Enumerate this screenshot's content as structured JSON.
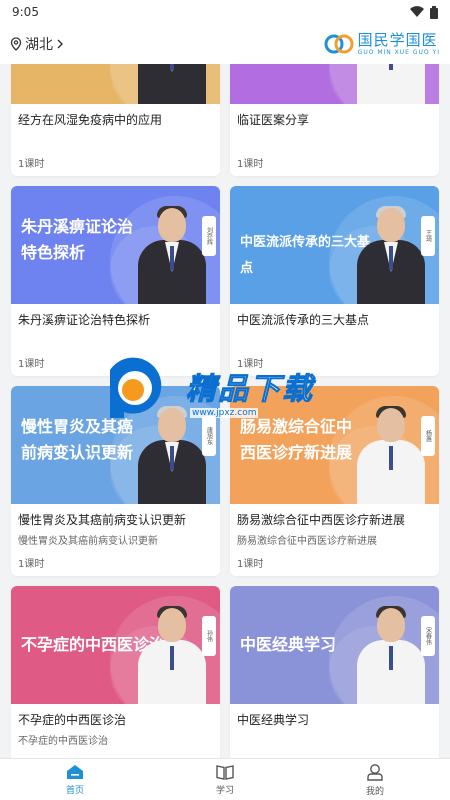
{
  "status": {
    "time": "9:05"
  },
  "header": {
    "location": "湖北",
    "brand_cn": "国民学国医",
    "brand_en": "GUO MIN XUE GUO YI"
  },
  "courses": [
    {
      "title": "经方在风湿免疫病中的应用",
      "subtitle": "",
      "lessons": "1课时",
      "thumb_title": "",
      "color": "#e6b566"
    },
    {
      "title": "临证医案分享",
      "subtitle": "",
      "lessons": "1课时",
      "thumb_title": "",
      "color": "#b26ee0"
    },
    {
      "title": "朱丹溪痹证论治特色探析",
      "subtitle": "",
      "lessons": "1课时",
      "thumb_title": "朱丹溪痹证论治特色探析",
      "color": "#6f83f0",
      "tag": "刘乔辉"
    },
    {
      "title": "中医流派传承的三大基点",
      "subtitle": "",
      "lessons": "1课时",
      "thumb_title": "中医流派传承的三大基点",
      "color": "#5aa0e6",
      "tag": "王琦"
    },
    {
      "title": "慢性胃炎及其癌前病变认识更新",
      "subtitle": "慢性胃炎及其癌前病变认识更新",
      "lessons": "1课时",
      "thumb_title": "慢性胃炎及其癌前病变认识更新",
      "color": "#6aa4e3",
      "tag": "唐旭东"
    },
    {
      "title": "肠易激综合征中西医诊疗新进展",
      "subtitle": "肠易激综合征中西医诊疗新进展",
      "lessons": "1课时",
      "thumb_title": "肠易激综合征中西医诊疗新进展",
      "color": "#f2a25a",
      "tag": "杨惠"
    },
    {
      "title": "不孕症的中西医诊治",
      "subtitle": "不孕症的中西医诊治",
      "lessons": "",
      "thumb_title": "不孕症的中西医诊治",
      "color": "#e05a86",
      "tag": "孙伟"
    },
    {
      "title": "中医经典学习",
      "subtitle": "",
      "lessons": "",
      "thumb_title": "中医经典学习",
      "color": "#8b93d8",
      "tag": "宋春伟"
    }
  ],
  "nav": [
    {
      "label": "首页",
      "icon": "home-icon",
      "active": true
    },
    {
      "label": "学习",
      "icon": "book-icon",
      "active": false
    },
    {
      "label": "我的",
      "icon": "profile-icon",
      "active": false
    }
  ],
  "watermark": {
    "text": "精品下载",
    "url": "www.jpxz.com"
  },
  "colors": {
    "accent": "#1f8fd6"
  }
}
